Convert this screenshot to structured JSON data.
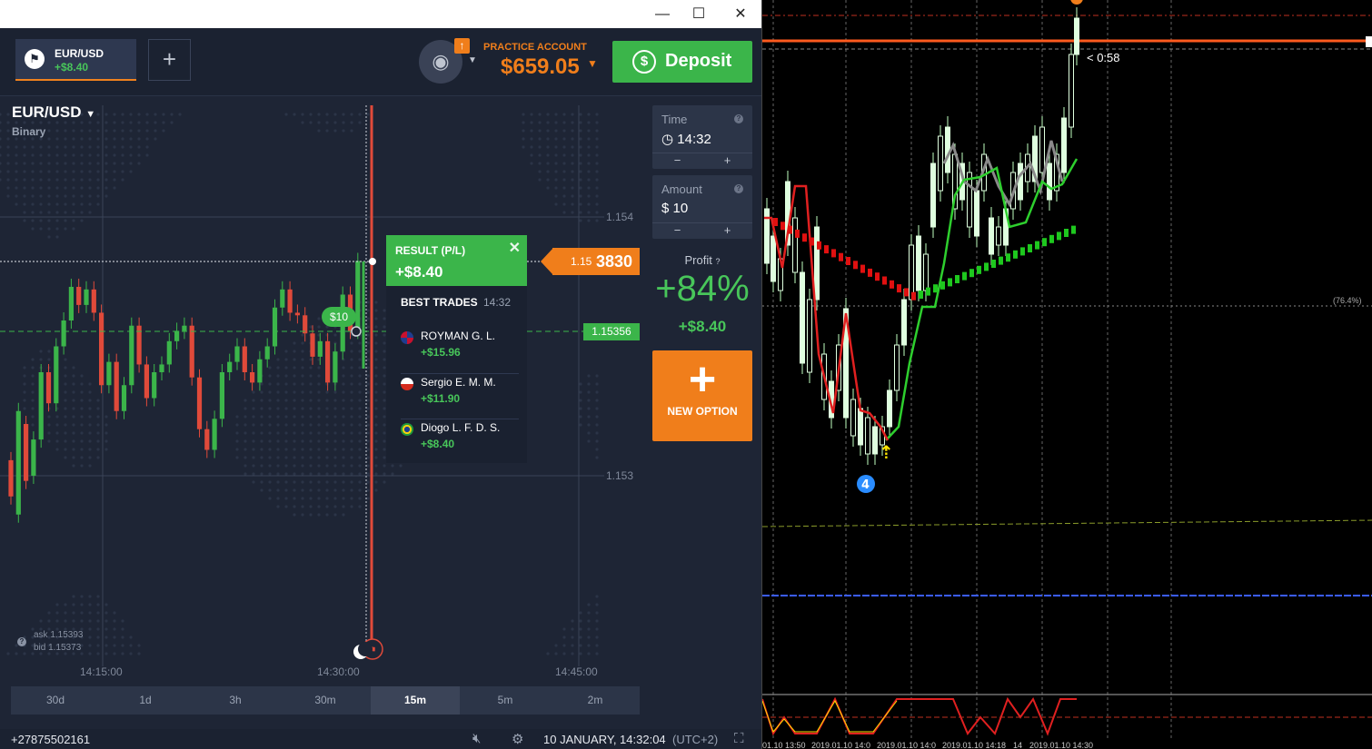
{
  "window": {
    "minimize_icon": "minimize-icon",
    "maximize_icon": "maximize-icon",
    "close_icon": "close-icon"
  },
  "topbar": {
    "asset_tab": {
      "name": "EUR/USD",
      "pl": "+$8.40"
    },
    "add_tab_label": "+",
    "practice_label": "PRACTICE ACCOUNT",
    "balance": "$659.05",
    "deposit_label": "Deposit"
  },
  "asset": {
    "title": "EUR/USD",
    "type": "Binary"
  },
  "panel": {
    "time_label": "Time",
    "time_value": "14:32",
    "amount_label": "Amount",
    "amount_value": "$  10",
    "minus": "−",
    "plus": "+",
    "profit_label": "Profit",
    "profit_pct": "+84%",
    "profit_value": "+$8.40",
    "new_option_label": "NEW OPTION"
  },
  "result": {
    "title": "RESULT (P/L)",
    "value": "+$8.40",
    "best_trades_label": "BEST TRADES",
    "best_trades_time": "14:32",
    "traders": [
      {
        "name": "ROYMAN G. L.",
        "value": "+$15.96",
        "flag": "dominican-flag"
      },
      {
        "name": "Sergio E. M. M.",
        "value": "+$11.90",
        "flag": "chile-flag"
      },
      {
        "name": "Diogo L. F. D. S.",
        "value": "+$8.40",
        "flag": "brazil-flag"
      }
    ]
  },
  "price": {
    "current_prefix": "1.15",
    "current_suffix": "3830",
    "open": "1.15356",
    "bet": "$10"
  },
  "ask_bid": {
    "ask": "ask 1.15393",
    "bid": "bid 1.15373"
  },
  "chart_data": [
    {
      "type": "candlestick",
      "title": "EUR/USD",
      "ylim": [
        1.1524,
        1.1546
      ],
      "y_ticks": [
        "1.154",
        "1.153"
      ],
      "x_ticks": [
        "14:15:00",
        "14:30:00",
        "14:45:00"
      ],
      "candles": [
        [
          0,
          1.15306,
          1.15292
        ],
        [
          1,
          1.15285,
          1.15325
        ],
        [
          2,
          1.1532,
          1.15298
        ],
        [
          3,
          1.153,
          1.15314
        ],
        [
          4,
          1.15314,
          1.1534
        ],
        [
          5,
          1.1534,
          1.15328
        ],
        [
          6,
          1.15328,
          1.1535
        ],
        [
          7,
          1.1535,
          1.1536
        ],
        [
          8,
          1.1536,
          1.15373
        ],
        [
          9,
          1.15373,
          1.15366
        ],
        [
          10,
          1.15366,
          1.15372
        ],
        [
          11,
          1.15372,
          1.15363
        ],
        [
          12,
          1.15363,
          1.15335
        ],
        [
          13,
          1.15335,
          1.15344
        ],
        [
          14,
          1.15344,
          1.15325
        ],
        [
          15,
          1.15325,
          1.15335
        ],
        [
          16,
          1.15335,
          1.15358
        ],
        [
          17,
          1.15358,
          1.15343
        ],
        [
          18,
          1.15343,
          1.1533
        ],
        [
          19,
          1.1533,
          1.1534
        ],
        [
          20,
          1.1534,
          1.15343
        ],
        [
          21,
          1.15343,
          1.15352
        ],
        [
          22,
          1.15352,
          1.15356
        ],
        [
          23,
          1.15356,
          1.15358
        ],
        [
          24,
          1.15358,
          1.15338
        ],
        [
          25,
          1.15338,
          1.15318
        ],
        [
          26,
          1.15318,
          1.1531
        ],
        [
          27,
          1.1531,
          1.15322
        ],
        [
          28,
          1.15322,
          1.1534
        ],
        [
          29,
          1.1534,
          1.15344
        ],
        [
          30,
          1.15344,
          1.1535
        ],
        [
          31,
          1.1535,
          1.1534
        ],
        [
          32,
          1.1534,
          1.15336
        ],
        [
          33,
          1.15336,
          1.15345
        ],
        [
          34,
          1.15345,
          1.1535
        ],
        [
          35,
          1.1535,
          1.15365
        ],
        [
          36,
          1.15365,
          1.15372
        ],
        [
          37,
          1.15372,
          1.15363
        ],
        [
          38,
          1.15363,
          1.15362
        ],
        [
          39,
          1.15362,
          1.15355
        ],
        [
          40,
          1.15355,
          1.15346
        ],
        [
          41,
          1.15346,
          1.15352
        ],
        [
          42,
          1.15352,
          1.15336
        ],
        [
          43,
          1.15336,
          1.15348
        ],
        [
          44,
          1.15348,
          1.1537
        ],
        [
          45,
          1.1537,
          1.15356
        ],
        [
          46,
          1.15356,
          1.15383
        ]
      ],
      "current_price": 1.15383,
      "open_price": 1.15356
    },
    {
      "type": "candlestick",
      "title": "",
      "label_fib": "(76.4%)",
      "countdown": "< 0:58",
      "marker": "4",
      "x_ticks": [
        "01.10 13:50",
        "2019.01.10 14:0",
        "2019.01.10 14:0",
        "2019.01.10 14:18",
        "14",
        "2019.01.10 14:30"
      ]
    }
  ],
  "timeframes": [
    "30d",
    "1d",
    "3h",
    "30m",
    "15m",
    "5m",
    "2m"
  ],
  "active_timeframe": "15m",
  "status": {
    "phone": "+27875502161",
    "datetime": "10 JANUARY, 14:32:04",
    "tz": "(UTC+2)"
  }
}
